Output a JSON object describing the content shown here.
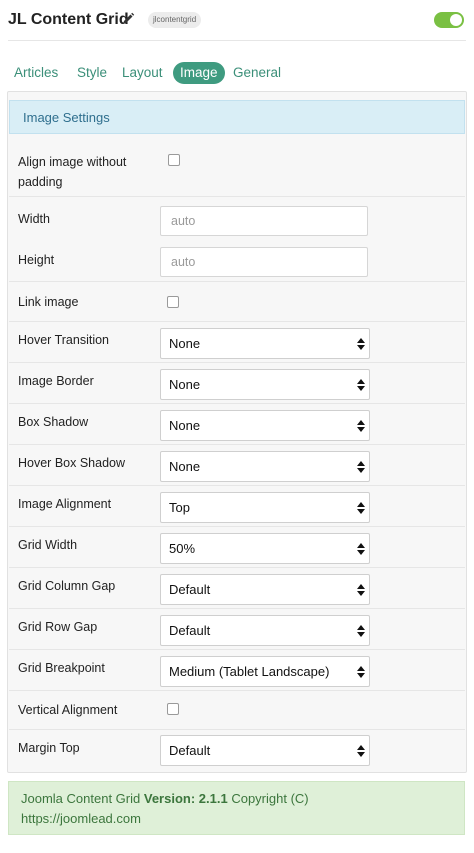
{
  "header": {
    "title": "JL Content Grid",
    "module_badge": "jlcontentgrid",
    "toggle_on": true,
    "toggle_color": "#7ac043"
  },
  "tabs": [
    {
      "label": "Articles",
      "active": false
    },
    {
      "label": "Style",
      "active": false
    },
    {
      "label": "Layout",
      "active": false
    },
    {
      "label": "Image",
      "active": true
    },
    {
      "label": "General",
      "active": false
    }
  ],
  "panel": {
    "heading": "Image Settings",
    "fields": {
      "align_without_padding": {
        "label_line1": "Align image without",
        "label_line2": "padding",
        "checked": false
      },
      "width": {
        "label": "Width",
        "placeholder": "auto",
        "value": ""
      },
      "height": {
        "label": "Height",
        "placeholder": "auto",
        "value": ""
      },
      "link_image": {
        "label": "Link image",
        "checked": false
      },
      "hover_transition": {
        "label": "Hover Transition",
        "selected": "None"
      },
      "image_border": {
        "label": "Image Border",
        "selected": "None"
      },
      "box_shadow": {
        "label": "Box Shadow",
        "selected": "None"
      },
      "hover_box_shadow": {
        "label": "Hover Box Shadow",
        "selected": "None"
      },
      "image_alignment": {
        "label": "Image Alignment",
        "selected": "Top"
      },
      "grid_width": {
        "label": "Grid Width",
        "selected": "50%"
      },
      "grid_column_gap": {
        "label": "Grid Column Gap",
        "selected": "Default"
      },
      "grid_row_gap": {
        "label": "Grid Row Gap",
        "selected": "Default"
      },
      "grid_breakpoint": {
        "label": "Grid Breakpoint",
        "selected": "Medium (Tablet Landscape)"
      },
      "vertical_alignment": {
        "label": "Vertical Alignment",
        "checked": false
      },
      "margin_top": {
        "label": "Margin Top",
        "selected": "Default"
      }
    }
  },
  "footer": {
    "prefix": "Joomla Content Grid",
    "version_label": "Version:",
    "version": "2.1.1",
    "copyright": "Copyright (C)",
    "url": "https://joomlead.com"
  },
  "colors": {
    "accent": "#3f9b80",
    "heading_bg": "#d9eef6",
    "footer_bg": "#dff0d8",
    "footer_text": "#3c763d"
  }
}
